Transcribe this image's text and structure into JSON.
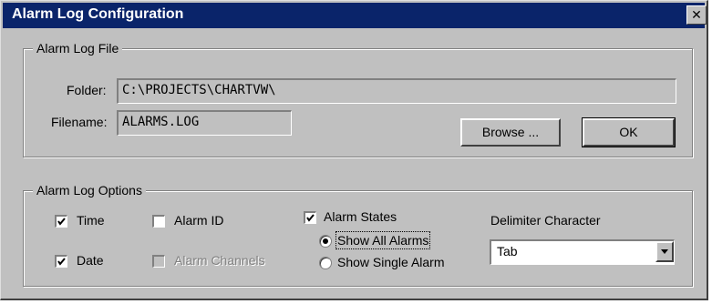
{
  "window": {
    "title": "Alarm Log Configuration",
    "close_glyph": "✕"
  },
  "alarm_log_file": {
    "legend": "Alarm Log File",
    "folder_label": "Folder:",
    "folder_value": "C:\\PROJECTS\\CHARTVW\\",
    "filename_label": "Filename:",
    "filename_value": "ALARMS.LOG",
    "browse_label": "Browse ...",
    "ok_label": "OK"
  },
  "alarm_log_options": {
    "legend": "Alarm Log Options",
    "time": {
      "label": "Time",
      "checked": true
    },
    "date": {
      "label": "Date",
      "checked": true
    },
    "alarm_id": {
      "label": "Alarm ID",
      "checked": false
    },
    "alarm_channels": {
      "label": "Alarm Channels",
      "checked": false,
      "disabled": true
    },
    "alarm_states": {
      "label": "Alarm States",
      "checked": true
    },
    "show_all_alarms": {
      "label": "Show All Alarms",
      "selected": true
    },
    "show_single_alarm": {
      "label": "Show Single Alarm",
      "selected": false
    },
    "delimiter_label": "Delimiter Character",
    "delimiter_value": "Tab"
  }
}
